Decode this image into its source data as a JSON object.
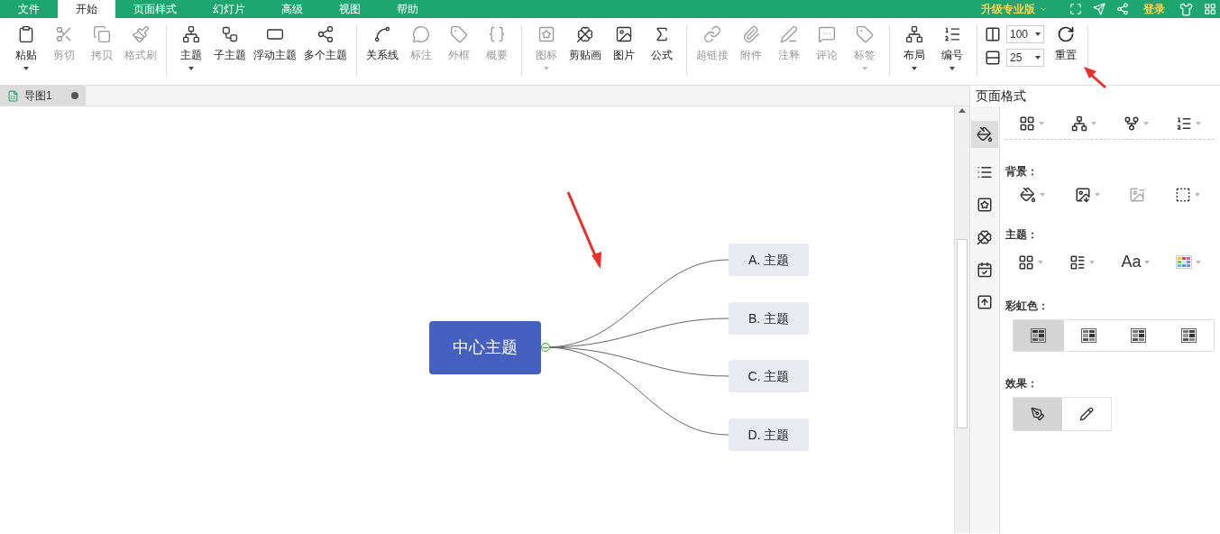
{
  "menu": {
    "tabs": [
      {
        "label": "文件",
        "selected": false
      },
      {
        "label": "开始",
        "selected": true
      },
      {
        "label": "页面样式",
        "selected": false
      },
      {
        "label": "幻灯片",
        "selected": false
      },
      {
        "label": "高级",
        "selected": false
      },
      {
        "label": "视图",
        "selected": false
      },
      {
        "label": "帮助",
        "selected": false
      }
    ],
    "upgrade": "升级专业版",
    "login": "登录"
  },
  "ribbon": [
    [
      {
        "label": "粘贴",
        "disabled": false,
        "dropdown": true
      },
      {
        "label": "剪切",
        "disabled": true,
        "dropdown": false
      },
      {
        "label": "拷贝",
        "disabled": true,
        "dropdown": false
      },
      {
        "label": "格式刷",
        "disabled": true,
        "dropdown": false
      }
    ],
    [
      {
        "label": "主题",
        "disabled": false,
        "dropdown": true
      },
      {
        "label": "子主题",
        "disabled": false,
        "dropdown": false
      },
      {
        "label": "浮动主题",
        "disabled": false,
        "dropdown": false
      },
      {
        "label": "多个主题",
        "disabled": false,
        "dropdown": false
      }
    ],
    [
      {
        "label": "关系线",
        "disabled": false,
        "dropdown": false
      },
      {
        "label": "标注",
        "disabled": true,
        "dropdown": false
      },
      {
        "label": "外框",
        "disabled": true,
        "dropdown": false
      },
      {
        "label": "概要",
        "disabled": true,
        "dropdown": false
      }
    ],
    [
      {
        "label": "图标",
        "disabled": true,
        "dropdown": true
      },
      {
        "label": "剪贴画",
        "disabled": false,
        "dropdown": false
      },
      {
        "label": "图片",
        "disabled": false,
        "dropdown": false
      },
      {
        "label": "公式",
        "disabled": false,
        "dropdown": false
      }
    ],
    [
      {
        "label": "超链接",
        "disabled": true,
        "dropdown": false
      },
      {
        "label": "附件",
        "disabled": true,
        "dropdown": false
      },
      {
        "label": "注释",
        "disabled": true,
        "dropdown": false
      },
      {
        "label": "评论",
        "disabled": true,
        "dropdown": false
      },
      {
        "label": "标签",
        "disabled": true,
        "dropdown": true
      }
    ],
    [
      {
        "label": "布局",
        "disabled": false,
        "dropdown": true
      },
      {
        "label": "编号",
        "disabled": false,
        "dropdown": true
      }
    ]
  ],
  "spacing": {
    "horizontal": "100",
    "vertical": "25"
  },
  "reset": "重置",
  "doc_tab": {
    "title": "导图1",
    "modified": true
  },
  "mindmap": {
    "center": "中心主题",
    "children": [
      "A. 主题",
      "B. 主题",
      "C. 主题",
      "D. 主题"
    ]
  },
  "panel": {
    "title": "页面格式",
    "background_label": "背景：",
    "theme_label": "主题：",
    "font_button": "Aa",
    "rainbow_label": "彩虹色：",
    "rainbow": [
      {
        "selected": true
      },
      {
        "selected": false
      },
      {
        "selected": false
      },
      {
        "selected": false
      }
    ],
    "effect_label": "效果：",
    "effects": [
      {
        "selected": true
      },
      {
        "selected": false
      }
    ]
  }
}
